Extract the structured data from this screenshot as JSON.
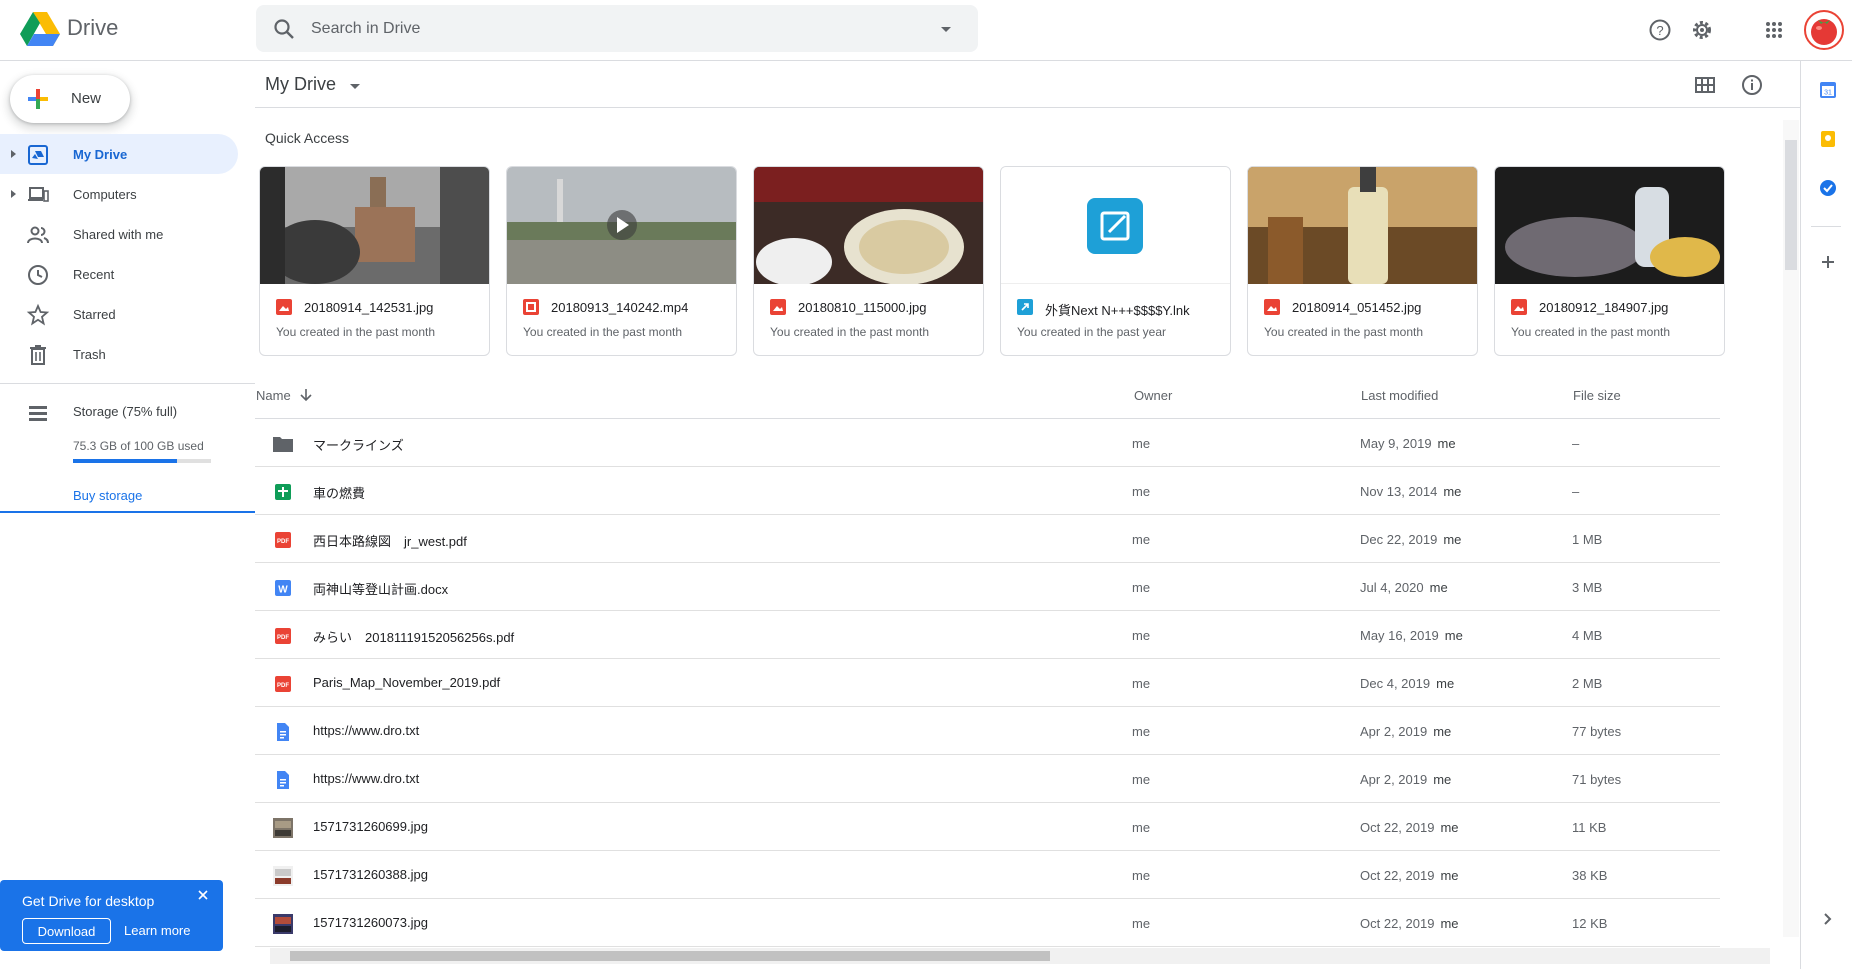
{
  "header": {
    "app_name": "Drive",
    "search_placeholder": "Search in Drive"
  },
  "nav": {
    "new_label": "New",
    "items": [
      {
        "label": "My Drive"
      },
      {
        "label": "Computers"
      },
      {
        "label": "Shared with me"
      },
      {
        "label": "Recent"
      },
      {
        "label": "Starred"
      },
      {
        "label": "Trash"
      }
    ],
    "storage": {
      "title": "Storage (75% full)",
      "used": "75.3 GB of 100 GB used",
      "percent": 75,
      "buy": "Buy storage"
    }
  },
  "promo": {
    "title": "Get Drive for desktop",
    "download": "Download",
    "learn_more": "Learn more"
  },
  "main": {
    "title": "My Drive",
    "quick_access_title": "Quick Access",
    "quick_access": [
      {
        "name": "20180914_142531.jpg",
        "sub": "You created in the past month",
        "icon": "image-icon"
      },
      {
        "name": "20180913_140242.mp4",
        "sub": "You created in the past month",
        "icon": "video-icon"
      },
      {
        "name": "20180810_115000.jpg",
        "sub": "You created in the past month",
        "icon": "image-icon"
      },
      {
        "name": "外貨Next N+++$$$$Y.lnk",
        "sub": "You created in the past year",
        "icon": "shortcut-icon"
      },
      {
        "name": "20180914_051452.jpg",
        "sub": "You created in the past month",
        "icon": "image-icon"
      },
      {
        "name": "20180912_184907.jpg",
        "sub": "You created in the past month",
        "icon": "image-icon"
      }
    ],
    "columns": {
      "name": "Name",
      "owner": "Owner",
      "modified": "Last modified",
      "size": "File size"
    },
    "files": [
      {
        "name": "マークラインズ",
        "owner": "me",
        "date": "May 9, 2019",
        "by": "me",
        "size": "–",
        "icon": "folder-icon"
      },
      {
        "name": "車の燃費",
        "owner": "me",
        "date": "Nov 13, 2014",
        "by": "me",
        "size": "–",
        "icon": "sheets-icon"
      },
      {
        "name": "西日本路線図　jr_west.pdf",
        "owner": "me",
        "date": "Dec 22, 2019",
        "by": "me",
        "size": "1 MB",
        "icon": "pdf-icon"
      },
      {
        "name": "両神山等登山計画.docx",
        "owner": "me",
        "date": "Jul 4, 2020",
        "by": "me",
        "size": "3 MB",
        "icon": "word-icon"
      },
      {
        "name": "みらい　20181119152056256s.pdf",
        "owner": "me",
        "date": "May 16, 2019",
        "by": "me",
        "size": "4 MB",
        "icon": "pdf-icon"
      },
      {
        "name": "Paris_Map_November_2019.pdf",
        "owner": "me",
        "date": "Dec 4, 2019",
        "by": "me",
        "size": "2 MB",
        "icon": "pdf-icon"
      },
      {
        "name": "https://www.dro.txt",
        "owner": "me",
        "date": "Apr 2, 2019",
        "by": "me",
        "size": "77 bytes",
        "icon": "doc-icon"
      },
      {
        "name": "https://www.dro.txt",
        "owner": "me",
        "date": "Apr 2, 2019",
        "by": "me",
        "size": "71 bytes",
        "icon": "doc-icon"
      },
      {
        "name": "1571731260699.jpg",
        "owner": "me",
        "date": "Oct 22, 2019",
        "by": "me",
        "size": "11 KB",
        "icon": "image-thumb-icon"
      },
      {
        "name": "1571731260388.jpg",
        "owner": "me",
        "date": "Oct 22, 2019",
        "by": "me",
        "size": "38 KB",
        "icon": "image-thumb-icon"
      },
      {
        "name": "1571731260073.jpg",
        "owner": "me",
        "date": "Oct 22, 2019",
        "by": "me",
        "size": "12 KB",
        "icon": "image-thumb-icon"
      }
    ]
  }
}
